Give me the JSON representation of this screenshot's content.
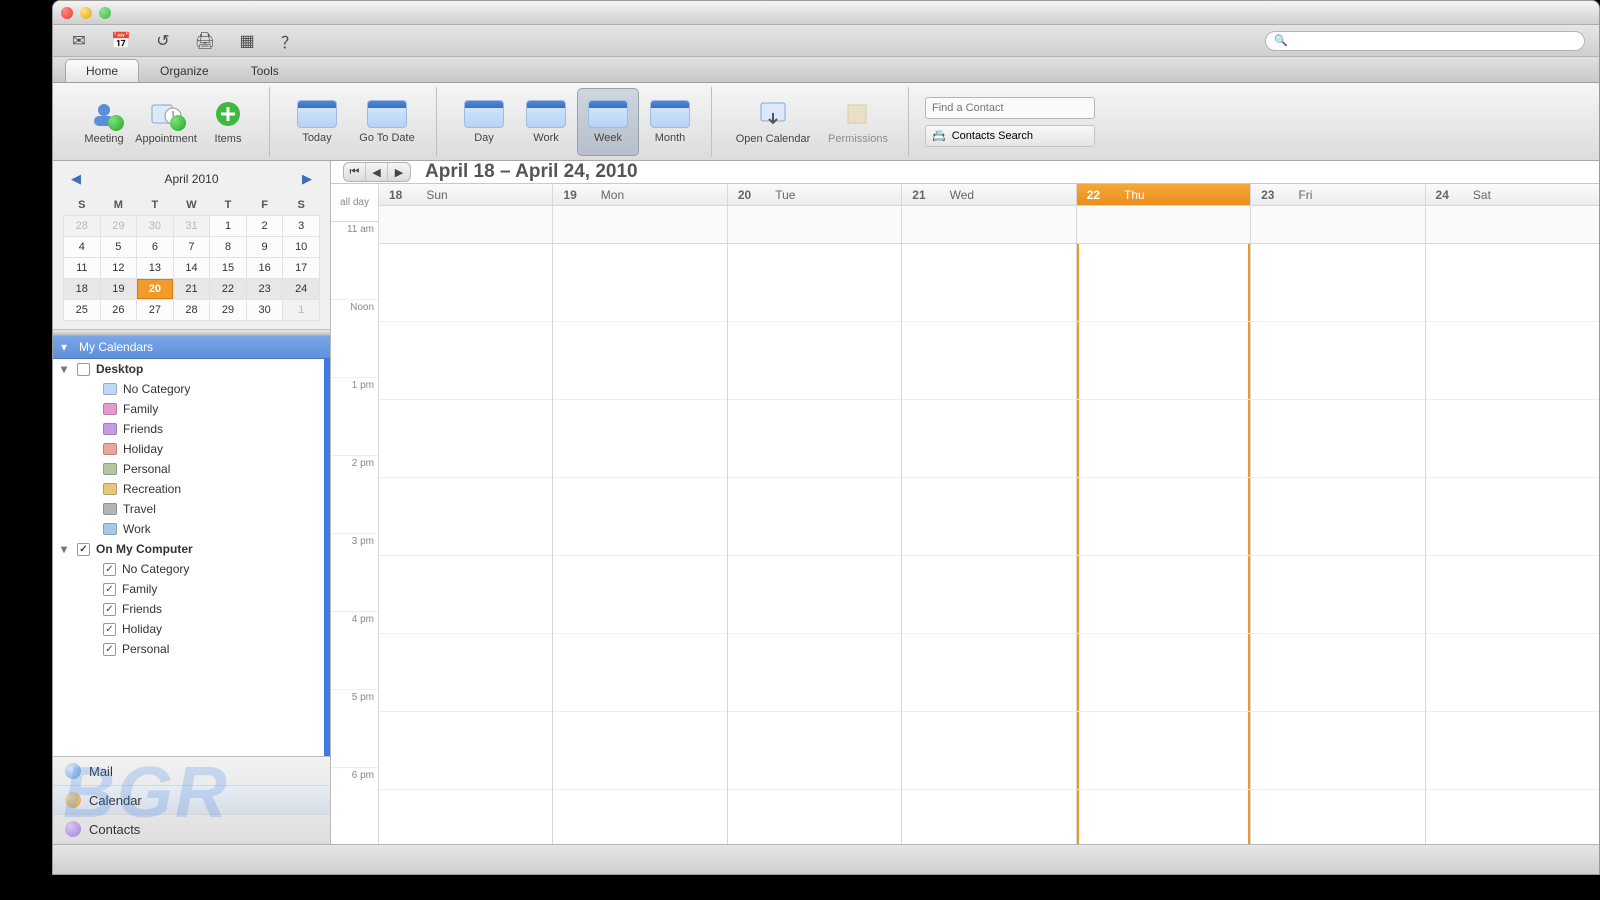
{
  "titlebar": {
    "title": ""
  },
  "tabs": {
    "home": "Home",
    "organize": "Organize",
    "tools": "Tools",
    "active": "home"
  },
  "ribbon": {
    "meeting": "Meeting",
    "appointment": "Appointment",
    "items": "Items",
    "today": "Today",
    "goto": "Go To Date",
    "day": "Day",
    "work": "Work",
    "week": "Week",
    "month": "Month",
    "open_calendar": "Open Calendar",
    "permissions": "Permissions",
    "find_placeholder": "Find a Contact",
    "contacts_search": "Contacts Search",
    "selected_view": "week"
  },
  "minical": {
    "label": "April 2010",
    "dow": [
      "S",
      "M",
      "T",
      "W",
      "T",
      "F",
      "S"
    ],
    "rows": [
      [
        {
          "d": "28",
          "dim": true
        },
        {
          "d": "29",
          "dim": true
        },
        {
          "d": "30",
          "dim": true
        },
        {
          "d": "31",
          "dim": true
        },
        {
          "d": "1"
        },
        {
          "d": "2"
        },
        {
          "d": "3"
        }
      ],
      [
        {
          "d": "4"
        },
        {
          "d": "5"
        },
        {
          "d": "6"
        },
        {
          "d": "7"
        },
        {
          "d": "8"
        },
        {
          "d": "9"
        },
        {
          "d": "10"
        }
      ],
      [
        {
          "d": "11"
        },
        {
          "d": "12"
        },
        {
          "d": "13"
        },
        {
          "d": "14"
        },
        {
          "d": "15"
        },
        {
          "d": "16"
        },
        {
          "d": "17"
        }
      ],
      [
        {
          "d": "18",
          "cw": true
        },
        {
          "d": "19",
          "cw": true
        },
        {
          "d": "20",
          "cw": true,
          "today": true
        },
        {
          "d": "21",
          "cw": true
        },
        {
          "d": "22",
          "cw": true
        },
        {
          "d": "23",
          "cw": true
        },
        {
          "d": "24",
          "cw": true
        }
      ],
      [
        {
          "d": "25"
        },
        {
          "d": "26"
        },
        {
          "d": "27"
        },
        {
          "d": "28"
        },
        {
          "d": "29"
        },
        {
          "d": "30"
        },
        {
          "d": "1",
          "dim": true
        }
      ]
    ]
  },
  "sidebar": {
    "header": "My Calendars",
    "groups": [
      {
        "name": "Desktop",
        "checked": false,
        "items": [
          {
            "label": "No Category",
            "color": "#bfd8f5"
          },
          {
            "label": "Family",
            "color": "#e59acb"
          },
          {
            "label": "Friends",
            "color": "#c79ae5"
          },
          {
            "label": "Holiday",
            "color": "#e8a79a"
          },
          {
            "label": "Personal",
            "color": "#b0c8a3"
          },
          {
            "label": "Recreation",
            "color": "#e8c77a"
          },
          {
            "label": "Travel",
            "color": "#b4b4b4"
          },
          {
            "label": "Work",
            "color": "#a8c8e8"
          }
        ]
      },
      {
        "name": "On My Computer",
        "checked": true,
        "items": [
          {
            "label": "No Category",
            "checked": true,
            "color": "#d9d9d9"
          },
          {
            "label": "Family",
            "checked": true,
            "color": "#e59acb"
          },
          {
            "label": "Friends",
            "checked": true,
            "color": "#c79ae5"
          },
          {
            "label": "Holiday",
            "checked": true,
            "color": "#e8a79a"
          },
          {
            "label": "Personal",
            "checked": true,
            "color": "#b0c8a3"
          }
        ]
      }
    ]
  },
  "nav": {
    "mail": "Mail",
    "calendar": "Calendar",
    "contacts": "Contacts",
    "active": "calendar"
  },
  "week": {
    "range": "April 18 – April 24, 2010",
    "days": [
      {
        "num": "18",
        "name": "Sun"
      },
      {
        "num": "19",
        "name": "Mon"
      },
      {
        "num": "20",
        "name": "Tue"
      },
      {
        "num": "21",
        "name": "Wed"
      },
      {
        "num": "22",
        "name": "Thu",
        "today": true
      },
      {
        "num": "23",
        "name": "Fri"
      },
      {
        "num": "24",
        "name": "Sat"
      }
    ],
    "allday": "all day",
    "hours": [
      "11 am",
      "Noon",
      "1 pm",
      "2 pm",
      "3 pm",
      "4 pm",
      "5 pm",
      "6 pm"
    ]
  },
  "watermark": "BGR"
}
